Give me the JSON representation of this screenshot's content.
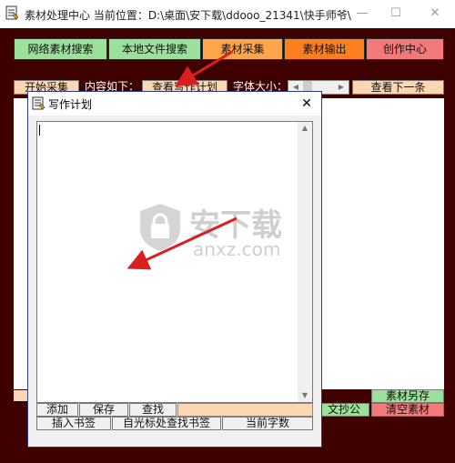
{
  "window": {
    "title": "素材处理中心  当前位置：D:\\桌面\\安下载\\ddooo_21341\\快手师爷\\",
    "minimize": "—",
    "maximize": "☐",
    "close": "✕"
  },
  "tabs": [
    {
      "label": "网络素材搜索",
      "color": "#9be09b"
    },
    {
      "label": "本地文件搜索",
      "color": "#9be09b"
    },
    {
      "label": "素材采集",
      "color": "#ffa64d"
    },
    {
      "label": "素材输出",
      "color": "#ff7f1f"
    },
    {
      "label": "创作中心",
      "color": "#f47a7a"
    }
  ],
  "toolbar": {
    "start_collect": "开始采集",
    "content_label": "内容如下：",
    "view_plan": "查看写作计划",
    "font_size_label": "字体大小：",
    "view_next": "查看下一条"
  },
  "bottom": {
    "save_material_as": "素材另存",
    "text_copy": "文抄公",
    "clear_material": "清空素材"
  },
  "dialog": {
    "title": "写作计划",
    "close": "✕",
    "add": "添加",
    "save": "保存",
    "find": "查找",
    "insert_bookmark": "插入书签",
    "find_bookmark_at_cursor": "自光标处查找书签",
    "current_word_count": "当前字数"
  },
  "watermark": {
    "text": "安下载",
    "subtext": "anxz.com"
  },
  "colors": {
    "frame": "#3f0000",
    "annotation_arrow": "#d92020"
  }
}
